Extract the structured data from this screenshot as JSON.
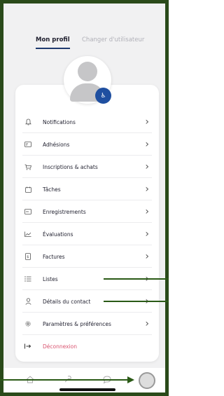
{
  "tabs": {
    "active": "Mon profil",
    "inactive": "Changer d'utilisateur"
  },
  "menu": [
    {
      "label": "Notifications",
      "icon": "bell-icon"
    },
    {
      "label": "Adhésions",
      "icon": "card-icon"
    },
    {
      "label": "Inscriptions & achats",
      "icon": "cart-icon"
    },
    {
      "label": "Tâches",
      "icon": "calendar-icon"
    },
    {
      "label": "Enregistrements",
      "icon": "ticket-icon"
    },
    {
      "label": "Évaluations",
      "icon": "chart-icon"
    },
    {
      "label": "Factures",
      "icon": "invoice-icon"
    },
    {
      "label": "Listes",
      "icon": "list-icon"
    },
    {
      "label": "Détails du contact",
      "icon": "person-icon"
    },
    {
      "label": "Paramètres & préférences",
      "icon": "gear-icon"
    }
  ],
  "logout": {
    "label": "Déconnexion",
    "icon": "logout-icon"
  },
  "colors": {
    "frame": "#2a4a1a",
    "accent": "#1f3a6e",
    "logout": "#d9536f"
  }
}
